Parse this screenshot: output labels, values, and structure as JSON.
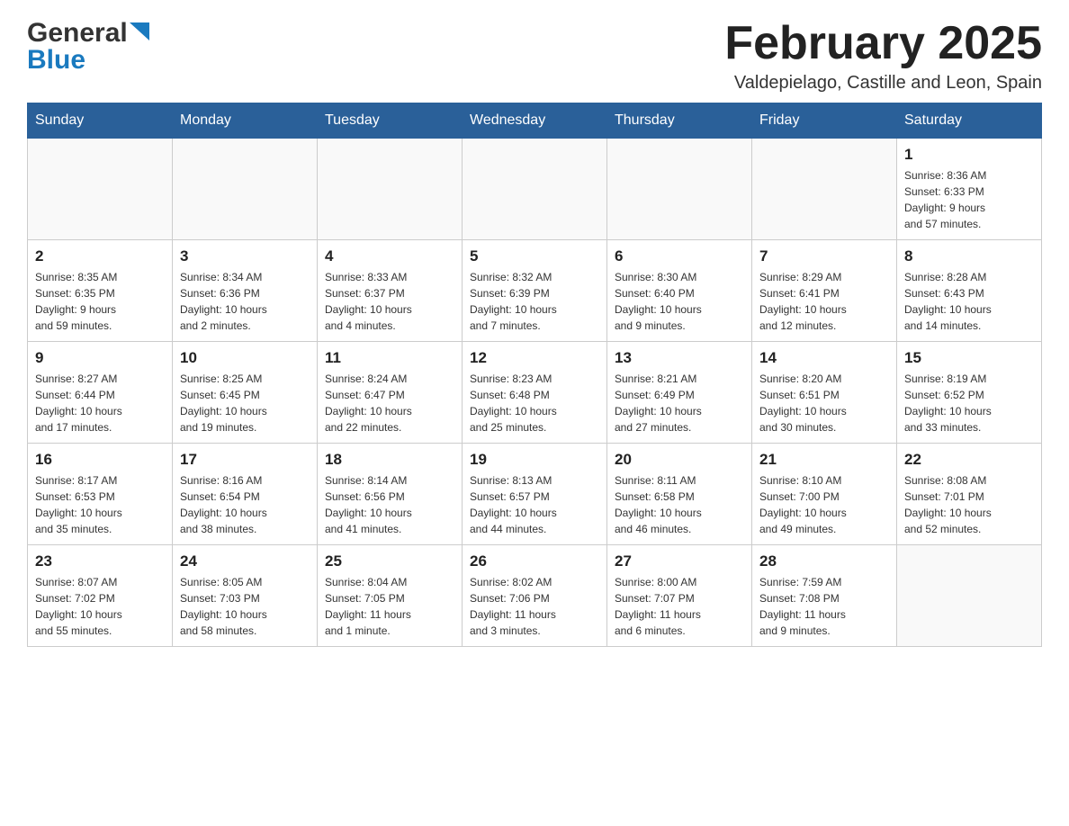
{
  "header": {
    "logo_general": "General",
    "logo_blue": "Blue",
    "month_title": "February 2025",
    "location": "Valdepielago, Castille and Leon, Spain"
  },
  "days_of_week": [
    "Sunday",
    "Monday",
    "Tuesday",
    "Wednesday",
    "Thursday",
    "Friday",
    "Saturday"
  ],
  "weeks": [
    [
      {
        "day": "",
        "info": ""
      },
      {
        "day": "",
        "info": ""
      },
      {
        "day": "",
        "info": ""
      },
      {
        "day": "",
        "info": ""
      },
      {
        "day": "",
        "info": ""
      },
      {
        "day": "",
        "info": ""
      },
      {
        "day": "1",
        "info": "Sunrise: 8:36 AM\nSunset: 6:33 PM\nDaylight: 9 hours\nand 57 minutes."
      }
    ],
    [
      {
        "day": "2",
        "info": "Sunrise: 8:35 AM\nSunset: 6:35 PM\nDaylight: 9 hours\nand 59 minutes."
      },
      {
        "day": "3",
        "info": "Sunrise: 8:34 AM\nSunset: 6:36 PM\nDaylight: 10 hours\nand 2 minutes."
      },
      {
        "day": "4",
        "info": "Sunrise: 8:33 AM\nSunset: 6:37 PM\nDaylight: 10 hours\nand 4 minutes."
      },
      {
        "day": "5",
        "info": "Sunrise: 8:32 AM\nSunset: 6:39 PM\nDaylight: 10 hours\nand 7 minutes."
      },
      {
        "day": "6",
        "info": "Sunrise: 8:30 AM\nSunset: 6:40 PM\nDaylight: 10 hours\nand 9 minutes."
      },
      {
        "day": "7",
        "info": "Sunrise: 8:29 AM\nSunset: 6:41 PM\nDaylight: 10 hours\nand 12 minutes."
      },
      {
        "day": "8",
        "info": "Sunrise: 8:28 AM\nSunset: 6:43 PM\nDaylight: 10 hours\nand 14 minutes."
      }
    ],
    [
      {
        "day": "9",
        "info": "Sunrise: 8:27 AM\nSunset: 6:44 PM\nDaylight: 10 hours\nand 17 minutes."
      },
      {
        "day": "10",
        "info": "Sunrise: 8:25 AM\nSunset: 6:45 PM\nDaylight: 10 hours\nand 19 minutes."
      },
      {
        "day": "11",
        "info": "Sunrise: 8:24 AM\nSunset: 6:47 PM\nDaylight: 10 hours\nand 22 minutes."
      },
      {
        "day": "12",
        "info": "Sunrise: 8:23 AM\nSunset: 6:48 PM\nDaylight: 10 hours\nand 25 minutes."
      },
      {
        "day": "13",
        "info": "Sunrise: 8:21 AM\nSunset: 6:49 PM\nDaylight: 10 hours\nand 27 minutes."
      },
      {
        "day": "14",
        "info": "Sunrise: 8:20 AM\nSunset: 6:51 PM\nDaylight: 10 hours\nand 30 minutes."
      },
      {
        "day": "15",
        "info": "Sunrise: 8:19 AM\nSunset: 6:52 PM\nDaylight: 10 hours\nand 33 minutes."
      }
    ],
    [
      {
        "day": "16",
        "info": "Sunrise: 8:17 AM\nSunset: 6:53 PM\nDaylight: 10 hours\nand 35 minutes."
      },
      {
        "day": "17",
        "info": "Sunrise: 8:16 AM\nSunset: 6:54 PM\nDaylight: 10 hours\nand 38 minutes."
      },
      {
        "day": "18",
        "info": "Sunrise: 8:14 AM\nSunset: 6:56 PM\nDaylight: 10 hours\nand 41 minutes."
      },
      {
        "day": "19",
        "info": "Sunrise: 8:13 AM\nSunset: 6:57 PM\nDaylight: 10 hours\nand 44 minutes."
      },
      {
        "day": "20",
        "info": "Sunrise: 8:11 AM\nSunset: 6:58 PM\nDaylight: 10 hours\nand 46 minutes."
      },
      {
        "day": "21",
        "info": "Sunrise: 8:10 AM\nSunset: 7:00 PM\nDaylight: 10 hours\nand 49 minutes."
      },
      {
        "day": "22",
        "info": "Sunrise: 8:08 AM\nSunset: 7:01 PM\nDaylight: 10 hours\nand 52 minutes."
      }
    ],
    [
      {
        "day": "23",
        "info": "Sunrise: 8:07 AM\nSunset: 7:02 PM\nDaylight: 10 hours\nand 55 minutes."
      },
      {
        "day": "24",
        "info": "Sunrise: 8:05 AM\nSunset: 7:03 PM\nDaylight: 10 hours\nand 58 minutes."
      },
      {
        "day": "25",
        "info": "Sunrise: 8:04 AM\nSunset: 7:05 PM\nDaylight: 11 hours\nand 1 minute."
      },
      {
        "day": "26",
        "info": "Sunrise: 8:02 AM\nSunset: 7:06 PM\nDaylight: 11 hours\nand 3 minutes."
      },
      {
        "day": "27",
        "info": "Sunrise: 8:00 AM\nSunset: 7:07 PM\nDaylight: 11 hours\nand 6 minutes."
      },
      {
        "day": "28",
        "info": "Sunrise: 7:59 AM\nSunset: 7:08 PM\nDaylight: 11 hours\nand 9 minutes."
      },
      {
        "day": "",
        "info": ""
      }
    ]
  ]
}
